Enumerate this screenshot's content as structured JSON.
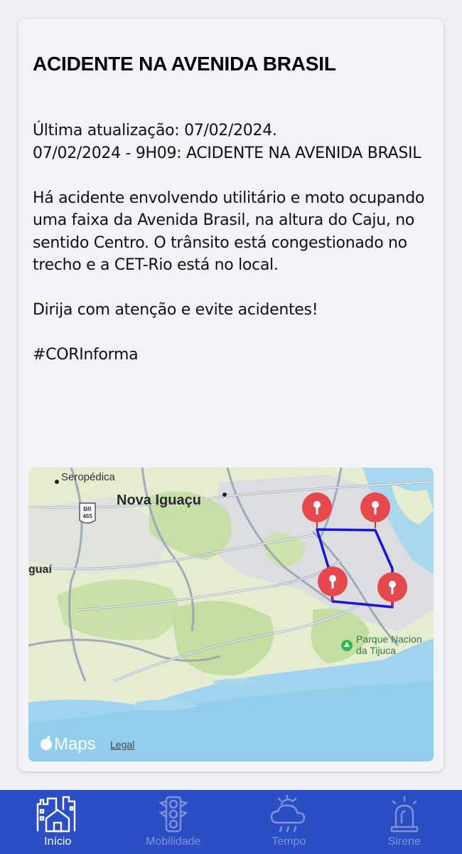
{
  "alert": {
    "title": "ACIDENTE NA AVENIDA BRASIL",
    "body": "Última atualização: 07/02/2024.\n07/02/2024 - 9H09: ACIDENTE NA AVENIDA BRASIL\n\nHá acidente envolvendo utilitário e moto ocupando uma faixa da Avenida Brasil, na altura do Caju, no sentido Centro. O trânsito está congestionado no trecho e a CET-Rio está no local.\n\nDirija com atenção e evite acidentes!\n\n#CORInforma"
  },
  "map": {
    "places": {
      "seropedica": "Seropédica",
      "nova_iguacu": "Nova Iguaçu",
      "guai": "guaí",
      "parque_line1": "Parque Nacion",
      "parque_line2": "da Tijuca",
      "highway": "BR",
      "highway_num": "465"
    },
    "attribution": "Maps",
    "legal": "Legal",
    "polygon_color": "#1418d6",
    "pin_color": "#e5484d"
  },
  "tabs": [
    {
      "label": "Início",
      "icon": "home-city-icon",
      "active": true
    },
    {
      "label": "Mobilidade",
      "icon": "traffic-light-icon",
      "active": false
    },
    {
      "label": "Tempo",
      "icon": "cloud-sun-rain-icon",
      "active": false
    },
    {
      "label": "Sirene",
      "icon": "siren-icon",
      "active": false
    }
  ],
  "colors": {
    "tabbar": "#2c4ec4",
    "tab_inactive": "#7f92d8",
    "tab_active": "#ffffff"
  }
}
